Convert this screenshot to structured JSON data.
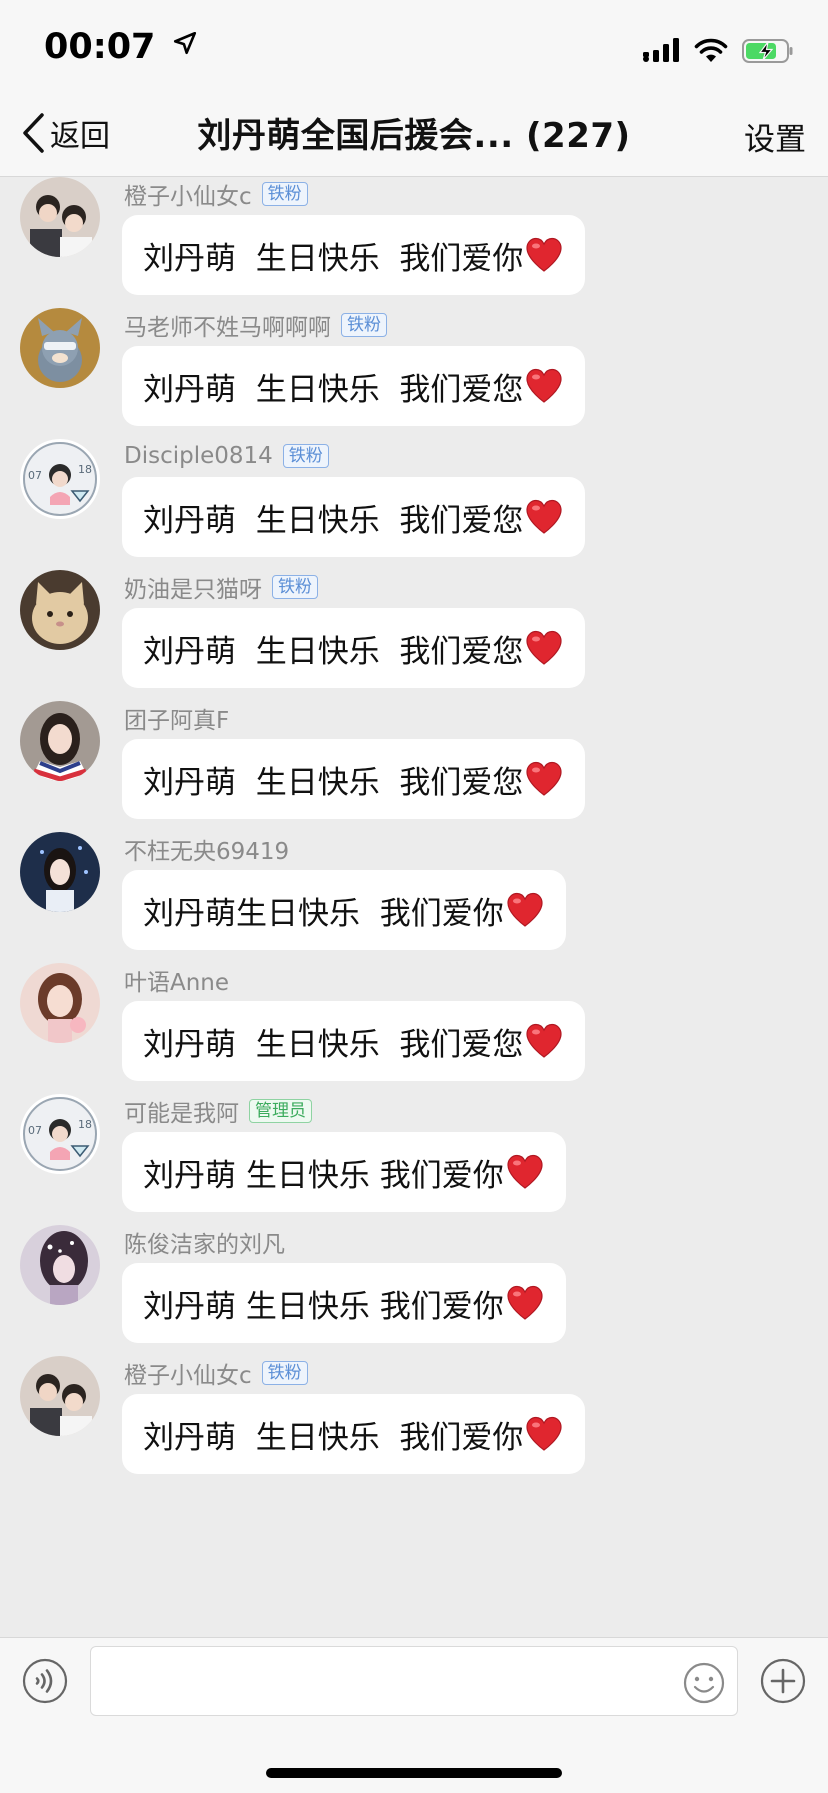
{
  "status_bar": {
    "time": "00:07",
    "location_icon": "location-arrow-icon",
    "signal_icon": "signal-icon",
    "wifi_icon": "wifi-icon",
    "battery_icon": "battery-charging-icon"
  },
  "nav": {
    "back_label": "返回",
    "title": "刘丹萌全国后援会... (227)",
    "settings_label": "设置"
  },
  "messages": [
    {
      "name": "橙子小仙女c",
      "badge": "铁粉",
      "badge_type": "fan",
      "text": "刘丹萌  生日快乐  我们爱你",
      "avatar": "group-photo-avatar"
    },
    {
      "name": "马老师不姓马啊啊啊",
      "badge": "铁粉",
      "badge_type": "fan",
      "text": "刘丹萌  生日快乐  我们爱您",
      "avatar": "cartoon-cat-avatar"
    },
    {
      "name": "Disciple0814",
      "badge": "铁粉",
      "badge_type": "fan",
      "text": "刘丹萌  生日快乐  我们爱您",
      "avatar": "birthday-badge-avatar"
    },
    {
      "name": "奶油是只猫呀",
      "badge": "铁粉",
      "badge_type": "fan",
      "text": "刘丹萌  生日快乐  我们爱您",
      "avatar": "cat-photo-avatar"
    },
    {
      "name": "团子阿真F",
      "badge": "",
      "badge_type": "",
      "text": "刘丹萌  生日快乐  我们爱您",
      "avatar": "girl-photo-avatar"
    },
    {
      "name": "不枉无央69419",
      "badge": "",
      "badge_type": "",
      "text": "刘丹萌生日快乐  我们爱你",
      "avatar": "girl-night-avatar"
    },
    {
      "name": "叶语Anne",
      "badge": "",
      "badge_type": "",
      "text": "刘丹萌  生日快乐  我们爱您",
      "avatar": "woman-portrait-avatar"
    },
    {
      "name": "可能是我阿",
      "badge": "管理员",
      "badge_type": "admin",
      "text": "刘丹萌 生日快乐 我们爱你",
      "avatar": "birthday-badge-avatar"
    },
    {
      "name": "陈俊洁家的刘凡",
      "badge": "",
      "badge_type": "",
      "text": "刘丹萌 生日快乐 我们爱你",
      "avatar": "purple-portrait-avatar"
    },
    {
      "name": "橙子小仙女c",
      "badge": "铁粉",
      "badge_type": "fan",
      "text": "刘丹萌  生日快乐  我们爱你",
      "avatar": "group-photo-avatar"
    }
  ],
  "bottom_bar": {
    "voice_icon": "voice-icon",
    "input_placeholder": "",
    "emoji_icon": "emoji-icon",
    "plus_icon": "plus-icon"
  },
  "colors": {
    "background": "#ececec",
    "bubble": "#ffffff",
    "fan_badge": "#5c8fd6",
    "admin_badge": "#3cab5d",
    "heart": "#e0262f"
  }
}
